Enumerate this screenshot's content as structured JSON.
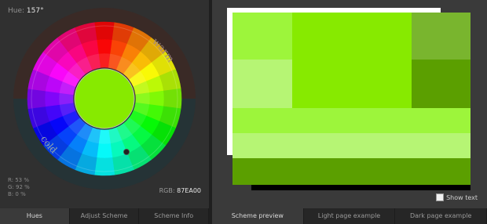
{
  "hue": {
    "label": "Hue:",
    "value": "157°"
  },
  "wheel": {
    "label_warm": "warm",
    "label_cold": "cold",
    "center_color": "#87EA00",
    "marker_icon": "selected-hue-dot-icon"
  },
  "rgb": {
    "r": "R: 53 %",
    "g": "G: 92 %",
    "b": "B: 0 %",
    "hex_label": "RGB:",
    "hex_value": "87EA00"
  },
  "left_tabs": [
    "Hues",
    "Adjust Scheme",
    "Scheme Info"
  ],
  "right_tabs": [
    "Scheme preview",
    "Light page example",
    "Dark page example"
  ],
  "show_text": {
    "label": "Show text",
    "checked": false
  },
  "palette": {
    "base": "#87EA00",
    "light_1": "#9DF53B",
    "light_2": "#B6F574",
    "dark_1": "#79B52E",
    "dark_2": "#5B9F00"
  }
}
